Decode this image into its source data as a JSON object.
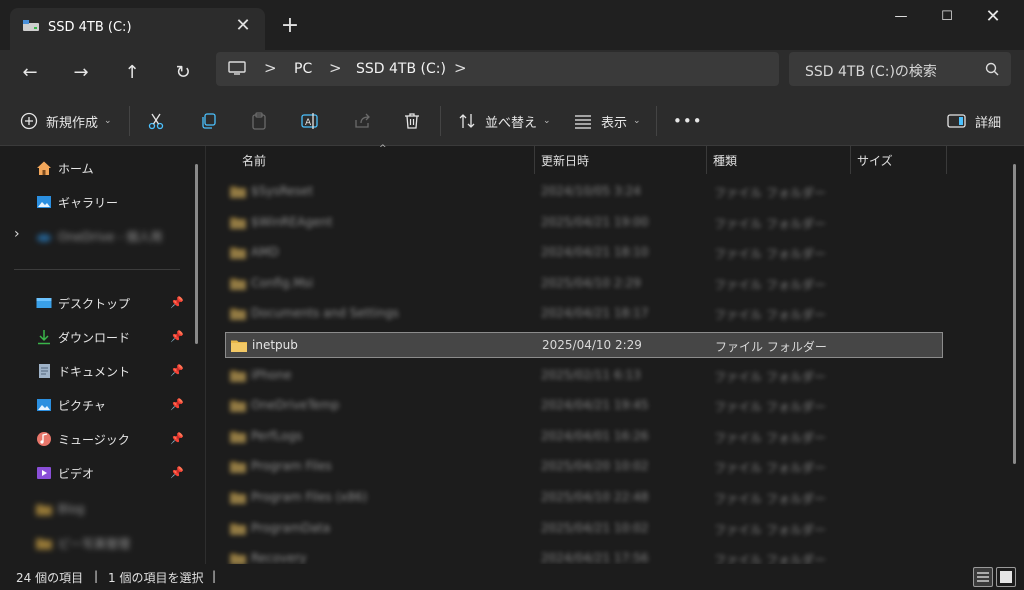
{
  "tab": {
    "title": "SSD 4TB (C:)",
    "close": "✕",
    "new_tab": "+"
  },
  "window": {
    "minimize": "—",
    "maximize": "☐",
    "close": "✕"
  },
  "nav": {
    "back": "←",
    "forward": "→",
    "up": "↑",
    "refresh": "↻"
  },
  "address": {
    "separators": [
      ">",
      ">",
      ">"
    ],
    "crumbs": [
      "PC",
      "SSD 4TB (C:)"
    ]
  },
  "search": {
    "placeholder": "SSD 4TB (C:)の検索"
  },
  "commands": {
    "new": "新規作成",
    "sort": "並べ替え",
    "view": "表示",
    "more": "•••",
    "details": "詳細"
  },
  "sidebar": {
    "home": "ホーム",
    "gallery": "ギャラリー",
    "onedrive": "OneDrive - 個人用",
    "desktop": "デスクトップ",
    "downloads": "ダウンロード",
    "documents": "ドキュメント",
    "pictures": "ピクチャ",
    "music": "ミュージック",
    "videos": "ビデオ",
    "blur1": "Blog",
    "blur2": "ピー写真管理"
  },
  "columns": {
    "name": "名前",
    "modified": "更新日時",
    "type": "種類",
    "size": "サイズ"
  },
  "rows": [
    {
      "name": "$SysReset",
      "date": "2024/10/05 3:24",
      "type": "ファイル フォルダー"
    },
    {
      "name": "$WinREAgent",
      "date": "2025/04/21 19:00",
      "type": "ファイル フォルダー"
    },
    {
      "name": "AMD",
      "date": "2024/04/21 18:10",
      "type": "ファイル フォルダー"
    },
    {
      "name": "Config.Msi",
      "date": "2025/04/10 2:29",
      "type": "ファイル フォルダー"
    },
    {
      "name": "Documents and Settings",
      "date": "2024/04/21 18:17",
      "type": "ファイル フォルダー"
    },
    {
      "name": "inetpub",
      "date": "2025/04/10 2:29",
      "type": "ファイル フォルダー"
    },
    {
      "name": "iPhone",
      "date": "2025/02/11 6:13",
      "type": "ファイル フォルダー"
    },
    {
      "name": "OneDriveTemp",
      "date": "2024/04/21 19:45",
      "type": "ファイル フォルダー"
    },
    {
      "name": "PerfLogs",
      "date": "2024/04/01 16:26",
      "type": "ファイル フォルダー"
    },
    {
      "name": "Program Files",
      "date": "2025/04/20 10:02",
      "type": "ファイル フォルダー"
    },
    {
      "name": "Program Files (x86)",
      "date": "2025/04/10 22:48",
      "type": "ファイル フォルダー"
    },
    {
      "name": "ProgramData",
      "date": "2025/04/21 10:02",
      "type": "ファイル フォルダー"
    },
    {
      "name": "Recovery",
      "date": "2024/04/21 17:56",
      "type": "ファイル フォルダー"
    }
  ],
  "status": {
    "count": "24 個の項目",
    "selected": "1 個の項目を選択",
    "sep": "|"
  },
  "colors": {
    "folder": "#e8b74a",
    "accent": "#4cc2ff"
  }
}
